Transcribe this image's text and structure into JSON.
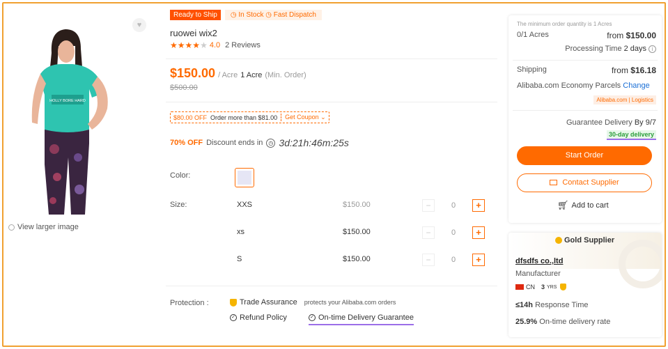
{
  "gallery": {
    "view_larger": "View larger image",
    "shirt_print": "HOLLY BORE HARD"
  },
  "product": {
    "badge_ready": "Ready to Ship",
    "badge_stock": "In Stock",
    "badge_dispatch": "Fast Dispatch",
    "title": "ruowei wix2",
    "rating_value": 4.0,
    "rating_text": "4.0",
    "reviews": "2 Reviews",
    "price": "$150.00",
    "price_unit": " / Acre",
    "min_order_qty": "1 Acre",
    "min_order_label": "(Min. Order)",
    "old_price": "$500.00",
    "coupon_discount": "$80.00 OFF",
    "coupon_condition": "Order more than $81.00",
    "coupon_button": "Get Coupon",
    "discount_pct": "70% OFF",
    "discount_ends_label": "Discount ends in",
    "countdown": "3d:21h:46m:25s",
    "color_label": "Color:",
    "size_label": "Size:",
    "sizes": [
      {
        "name": "XXS",
        "price": "$150.00",
        "qty": "0"
      },
      {
        "name": "xs",
        "price": "$150.00",
        "qty": "0"
      },
      {
        "name": "S",
        "price": "$150.00",
        "qty": "0"
      }
    ],
    "protection_label": "Protection :",
    "trade_assurance": "Trade Assurance",
    "trade_assurance_note": "protects your Alibaba.com orders",
    "refund_policy": "Refund Policy",
    "ontime_guarantee": "On-time Delivery Guarantee"
  },
  "order_panel": {
    "min_order_note": "The minimum order quantity is 1 Acres",
    "acres": "0/1 Acres",
    "from_label": "from",
    "from_price": "$150.00",
    "processing_label": "Processing Time",
    "processing_value": "2 days",
    "shipping_label": "Shipping",
    "shipping_price": "$16.18",
    "shipping_method": "Alibaba.com Economy Parcels",
    "change_link": "Change",
    "logistics_tag": "Alibaba.com | Logistics",
    "guarantee_label": "Guarantee Delivery",
    "guarantee_date": "By 9/7",
    "delivery_tag": "30-day delivery",
    "start_order": "Start Order",
    "contact_supplier": "Contact Supplier",
    "add_to_cart": "Add to cart"
  },
  "supplier": {
    "gold_label": "Gold Supplier",
    "name": "dfsdfs co.,ltd",
    "type": "Manufacturer",
    "country": "CN",
    "years": "3",
    "years_unit": "YRS",
    "response_value": "≤14h",
    "response_label": "Response Time",
    "ontime_value": "25.9%",
    "ontime_label": "On-time delivery rate"
  },
  "colors": {
    "accent": "#ff6a00",
    "guarantee_underline": "#9b6ee8",
    "delivery_tag_text": "#2a9d3a"
  }
}
